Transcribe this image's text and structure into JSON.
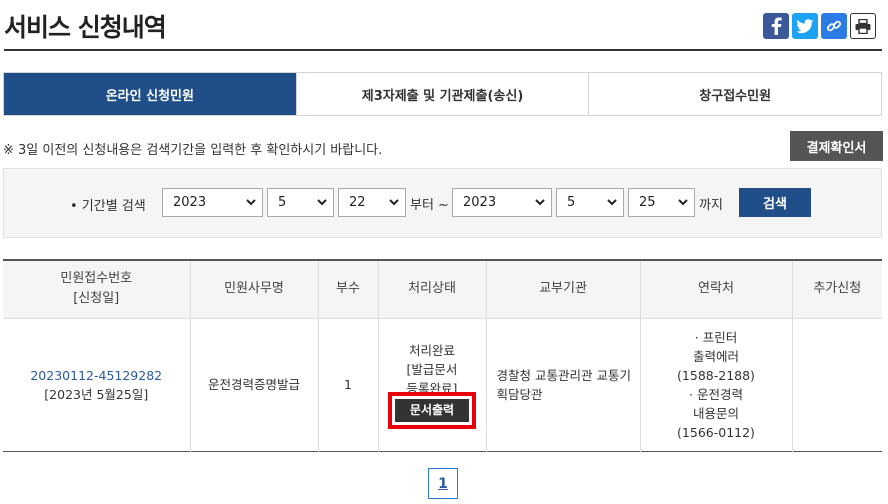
{
  "page": {
    "title": "서비스 신청내역"
  },
  "tabs": [
    {
      "label": "온라인 신청민원",
      "active": true
    },
    {
      "label": "제3자제출 및 기관제출(송신)",
      "active": false
    },
    {
      "label": "창구접수민원",
      "active": false
    }
  ],
  "notice": "※ 3일 이전의 신청내용은 검색기간을 입력한 후 확인하시기 바랍니다.",
  "receipt_button": "결제확인서",
  "search": {
    "label": "• 기간별 검색",
    "from_year": "2023",
    "from_month": "5",
    "from_day": "22",
    "from_suffix": "부터 ~",
    "to_year": "2023",
    "to_month": "5",
    "to_day": "25",
    "to_suffix": "까지",
    "button": "검색"
  },
  "table": {
    "headers": [
      "민원접수번호",
      "[신청일]",
      "민원사무명",
      "부수",
      "처리상태",
      "교부기관",
      "연락처",
      "추가신청"
    ],
    "row": {
      "receipt_no": "20230112-45129282",
      "apply_date": "[2023년 5월25일]",
      "service": "운전경력증명발급",
      "copies": "1",
      "status_1": "처리완료",
      "status_2": "[발급문서",
      "status_3": "등록완료]",
      "doc_button": "문서출력",
      "agency": "경찰청 교통관리관 교통기획담당관",
      "contact_1": "· 프린터",
      "contact_2": "출력에러",
      "contact_3": "(1588-2188)",
      "contact_4": "· 운전경력",
      "contact_5": "내용문의",
      "contact_6": "(1566-0112)",
      "extra": ""
    }
  },
  "pagination": {
    "current": "1"
  },
  "colors": {
    "primary": "#1f4e89",
    "highlight": "#e8000b"
  },
  "icons": [
    "facebook-icon",
    "twitter-icon",
    "link-icon",
    "print-icon",
    "chevron-down-icon"
  ]
}
